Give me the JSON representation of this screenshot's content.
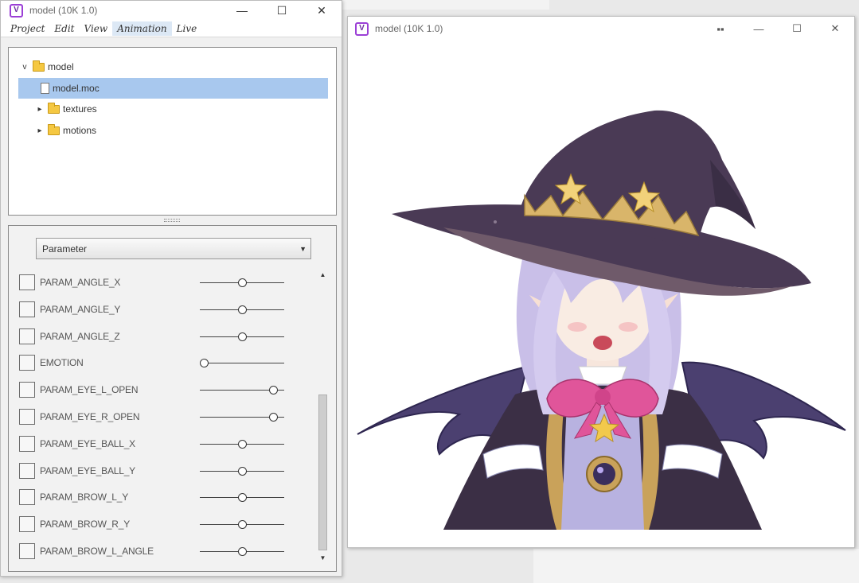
{
  "left_window": {
    "title": "model (10K 1.0)",
    "icon_letter": "V",
    "buttons": {
      "minimize": "—",
      "maximize": "☐",
      "close": "✕"
    },
    "menu": [
      "Project",
      "Edit",
      "View",
      "Animation",
      "Live"
    ],
    "active_menu_index": 3,
    "tree": {
      "root": "model",
      "selected_file": "model.moc",
      "folders": [
        "textures",
        "motions"
      ]
    },
    "dropdown_value": "Parameter",
    "parameters": [
      {
        "name": "PARAM_ANGLE_X",
        "value": 0.5
      },
      {
        "name": "PARAM_ANGLE_Y",
        "value": 0.5
      },
      {
        "name": "PARAM_ANGLE_Z",
        "value": 0.5
      },
      {
        "name": "EMOTION",
        "value": 0.05
      },
      {
        "name": "PARAM_EYE_L_OPEN",
        "value": 0.87
      },
      {
        "name": "PARAM_EYE_R_OPEN",
        "value": 0.87
      },
      {
        "name": "PARAM_EYE_BALL_X",
        "value": 0.5
      },
      {
        "name": "PARAM_EYE_BALL_Y",
        "value": 0.5
      },
      {
        "name": "PARAM_BROW_L_Y",
        "value": 0.5
      },
      {
        "name": "PARAM_BROW_R_Y",
        "value": 0.5
      },
      {
        "name": "PARAM_BROW_L_ANGLE",
        "value": 0.5
      }
    ]
  },
  "right_window": {
    "title": "model (10K 1.0)",
    "icon_letter": "V",
    "buttons": {
      "extra": "▪▪",
      "minimize": "—",
      "maximize": "☐",
      "close": "✕"
    }
  },
  "colors": {
    "app_icon": "#9b3fd6",
    "selection": "#a8c8ee",
    "hat": "#4a3a55",
    "hair": "#c9bfe8",
    "bow": "#e0559a",
    "wing": "#4b4070"
  }
}
